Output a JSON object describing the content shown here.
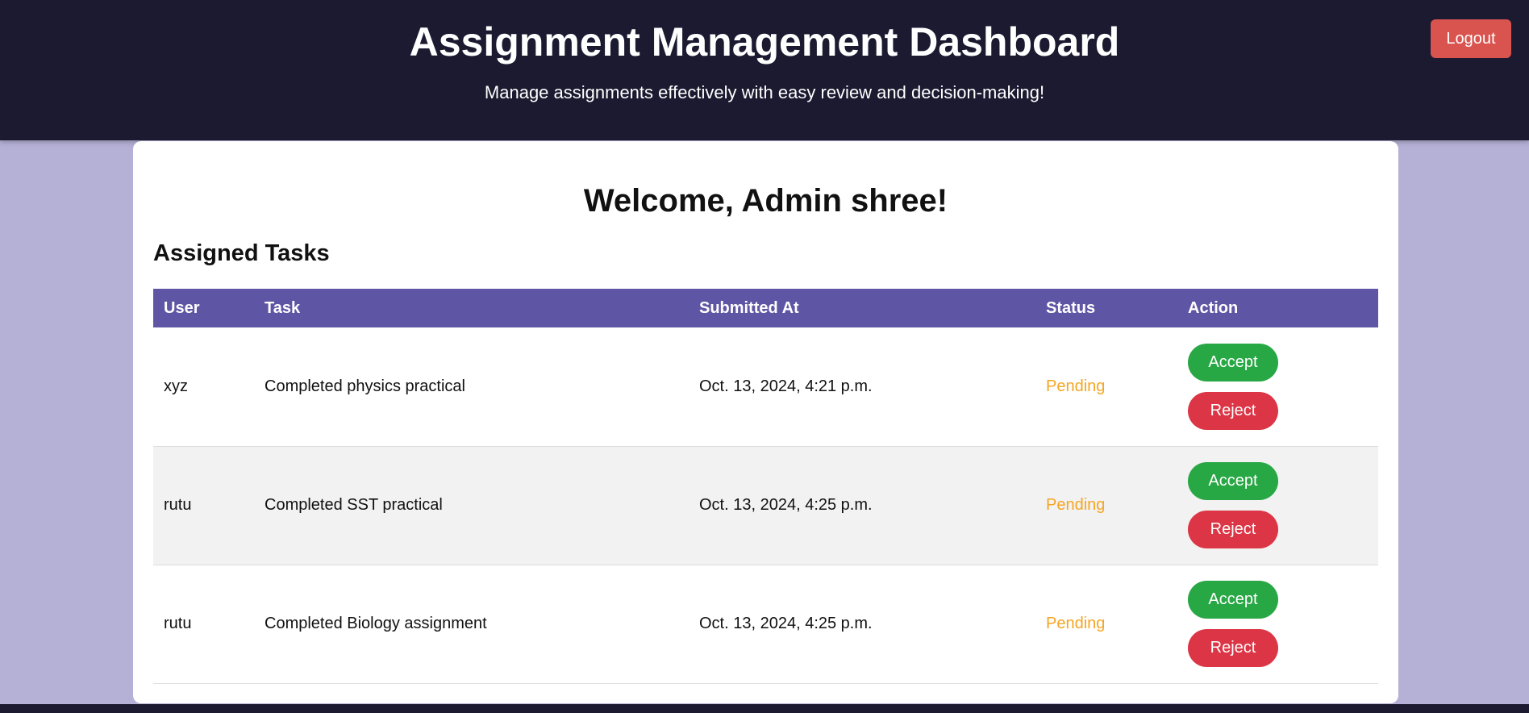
{
  "header": {
    "title": "Assignment Management Dashboard",
    "subtitle": "Manage assignments effectively with easy review and decision-making!",
    "logout_label": "Logout"
  },
  "main": {
    "welcome": "Welcome, Admin shree!",
    "section_title": "Assigned Tasks",
    "table": {
      "columns": [
        "User",
        "Task",
        "Submitted At",
        "Status",
        "Action"
      ],
      "rows": [
        {
          "user": "xyz",
          "task": "Completed physics practical",
          "submitted_at": "Oct. 13, 2024, 4:21 p.m.",
          "status": "Pending",
          "accept_label": "Accept",
          "reject_label": "Reject"
        },
        {
          "user": "rutu",
          "task": "Completed SST practical",
          "submitted_at": "Oct. 13, 2024, 4:25 p.m.",
          "status": "Pending",
          "accept_label": "Accept",
          "reject_label": "Reject"
        },
        {
          "user": "rutu",
          "task": "Completed Biology assignment",
          "submitted_at": "Oct. 13, 2024, 4:25 p.m.",
          "status": "Pending",
          "accept_label": "Accept",
          "reject_label": "Reject"
        }
      ]
    }
  },
  "colors": {
    "header_bg": "#1b1a30",
    "page_bg": "#b5b0d6",
    "table_header_bg": "#5f55a5",
    "accept": "#28a745",
    "reject": "#dc3545",
    "logout": "#d9534f",
    "pending": "#f5a623"
  }
}
